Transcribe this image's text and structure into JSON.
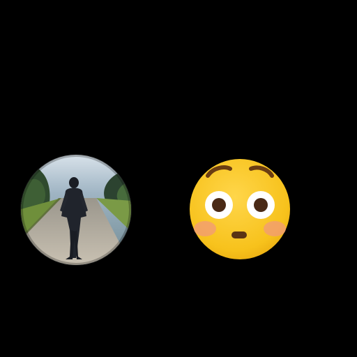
{
  "screen": {
    "background_color": "#000000"
  },
  "avatar": {
    "kind": "profile-photo",
    "subject": "person-walking-on-road"
  },
  "reaction": {
    "icon": "flushed-face-icon",
    "emoji": "😳",
    "face_color": "#F7C21C",
    "blush_color": "#F29A7A"
  }
}
